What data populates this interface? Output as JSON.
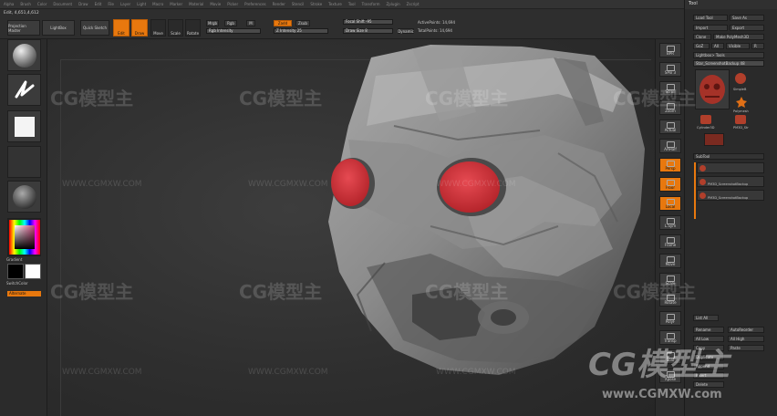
{
  "menu": [
    "Alpha",
    "Brush",
    "Color",
    "Document",
    "Draw",
    "Edit",
    "File",
    "Layer",
    "Light",
    "Macro",
    "Marker",
    "Material",
    "Movie",
    "Picker",
    "Preferences",
    "Render",
    "Stencil",
    "Stroke",
    "Texture",
    "Tool",
    "Transform",
    "Zplugin",
    "Zscript"
  ],
  "title_line": "Edit, 4,651,4,612",
  "toolbar": {
    "projection_master": "Projection Master",
    "lightbox": "LightBox",
    "quick_sketch": "Quick Sketch",
    "edit": "Edit",
    "draw": "Draw",
    "move": "Move",
    "scale": "Scale",
    "rotate": "Rotate",
    "mrgb": "Mrgb",
    "rgb": "Rgb",
    "m": "M",
    "rgb_intensity": "Rgb Intensity",
    "zadd": "Zadd",
    "zsub": "Zsub",
    "z_intensity": "Z Intensity 25",
    "focal_shift": "Focal Shift -95",
    "draw_size": "Draw Size 8",
    "dynamic": "Dynamic",
    "active_points": "ActivePoints: 14,694",
    "total_points": "TotalPoints: 14,694"
  },
  "left": {
    "gradient_label": "Gradient",
    "switch_color": "SwitchColor",
    "alternate": "Alternate"
  },
  "right_shelf": [
    "BPR",
    "SPix 3",
    "Scroll",
    "Zoom",
    "Actual",
    "AAHalf",
    "Persp",
    "Floor",
    "Local",
    "L.Sym",
    "Frame",
    "Move",
    "Scale",
    "Rotate",
    "PolyF",
    "Transp",
    "Solo",
    "Xpose"
  ],
  "tool_panel": {
    "title": "Tool",
    "load_tool": "Load Tool",
    "save_as": "Save As",
    "import": "Import",
    "export": "Export",
    "clone": "Clone",
    "make_polymesh3d": "Make PolyMesh3D",
    "goz": "GoZ",
    "all": "All",
    "visible": "Visible",
    "r": "R",
    "lightbox_tools": "Lightbox> Tools",
    "current_tool": "Star_ScreenshotBackup 48",
    "thumb_caps": [
      "Star_S...",
      "SimpleB",
      "Polymesh",
      "Cylinder3D",
      "PM3D_Str"
    ],
    "subtool": "SubTool",
    "subtool_rows": [
      "PM3D_ScreenshotBackup",
      "PM3D_ScreenshotBackup"
    ],
    "list_all": "List All",
    "new_folder": "New Folder",
    "rename": "Rename",
    "autoreorder": "AutoReorder",
    "all_low": "All Low",
    "all_high": "All High",
    "copy": "Copy",
    "paste": "Paste",
    "duplicate": "Duplicate",
    "append": "Append",
    "insert": "Insert",
    "delete": "Delete"
  },
  "watermark": {
    "logo": "CG模型主",
    "url": "WWW.CGMXW.COM",
    "url_lower": "www.CGMXW.com"
  },
  "colors": {
    "accent_orange": "#e8780e",
    "eye_red": "#d1303a",
    "background": "#262626"
  }
}
